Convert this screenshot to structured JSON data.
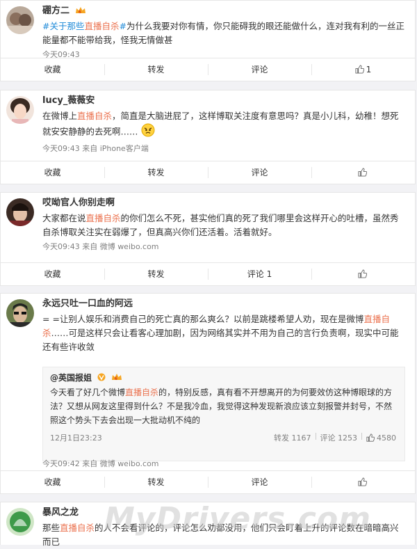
{
  "comments": [
    {
      "username": "硼方二",
      "text_parts": [
        {
          "t": "#关于那些",
          "c": "hash"
        },
        {
          "t": "直播自杀",
          "c": "kw"
        },
        {
          "t": "#",
          "c": "hash"
        },
        {
          "t": "为什么我要对你有情，你只能碍我的眼还能做什么，连对我有利的一丝正能量都不能带给我，怪我无情做甚",
          "c": ""
        }
      ],
      "meta": "今天09:43",
      "actions": {
        "collect": "收藏",
        "repost": "转发",
        "comment": "评论",
        "like": "1"
      }
    },
    {
      "username": "lucy_薇薇安",
      "text_parts": [
        {
          "t": "在微博上",
          "c": ""
        },
        {
          "t": "直播自杀",
          "c": "kw"
        },
        {
          "t": "，简直是大脑进屁了，这样博取关注度有意思吗？真是小儿科，幼稚！想死就安安静静的去死啊……",
          "c": ""
        }
      ],
      "meta": "今天09:43 来自 iPhone客户端",
      "actions": {
        "collect": "收藏",
        "repost": "转发",
        "comment": "评论",
        "like": ""
      }
    },
    {
      "username": "哎呦官人你别走啊",
      "text_parts": [
        {
          "t": "大家都在说",
          "c": ""
        },
        {
          "t": "直播自杀",
          "c": "kw"
        },
        {
          "t": "的你们怎么不死，甚实他们真的死了我们哪里会这样开心的吐槽，虽然秀自杀博取关注实在弱爆了，但真高兴你们还活着。活着就好。",
          "c": ""
        }
      ],
      "meta": "今天09:43 来自 微博 weibo.com",
      "actions": {
        "collect": "收藏",
        "repost": "转发",
        "comment": "评论 1",
        "like": ""
      }
    },
    {
      "username": "永远只吐一口血的阿远",
      "text_parts": [
        {
          "t": "= =让别人娱乐和消费自己的死亡真的那么爽么？以前是跳楼希望人劝，现在是微博",
          "c": ""
        },
        {
          "t": "直播自杀",
          "c": "kw"
        },
        {
          "t": "……可是这样只会让看客心理加剧，因为网络其实并不用为自己的言行负责啊，现实中可能还有些许收敛",
          "c": ""
        }
      ],
      "repost": {
        "author": "@英国报姐",
        "text_parts": [
          {
            "t": "今天看了好几个微博",
            "c": ""
          },
          {
            "t": "直播自杀",
            "c": "kw"
          },
          {
            "t": "的，特别反感，真有看不开想离开的为何要效仿这种博眼球的方法？又想从网友这里得到什么？不是我冷血，我觉得这种发现新浪应该立刻报警并封号，不然照这个势头下去会出现一大批动机不纯的",
            "c": ""
          }
        ],
        "date": "12月1日23:23",
        "repost": "转发 1167",
        "comment": "评论 1253",
        "like": "4580"
      },
      "meta": "今天09:42 来自 微博 weibo.com",
      "actions": {
        "collect": "收藏",
        "repost": "转发",
        "comment": "评论",
        "like": ""
      }
    },
    {
      "username": "暴风之龙",
      "text_parts": [
        {
          "t": "那些",
          "c": ""
        },
        {
          "t": "直播自杀",
          "c": "kw"
        },
        {
          "t": "的人不会看评论的，评论怎么劝都没用，他们只会盯着上升的评论数在暗暗高兴而已",
          "c": ""
        }
      ]
    }
  ],
  "watermark": "MyDrivers.com",
  "colors": {
    "keyword": "#eb7350",
    "hashtag": "#1f8ad8",
    "meta": "#808080",
    "vip": "#f6a623"
  }
}
